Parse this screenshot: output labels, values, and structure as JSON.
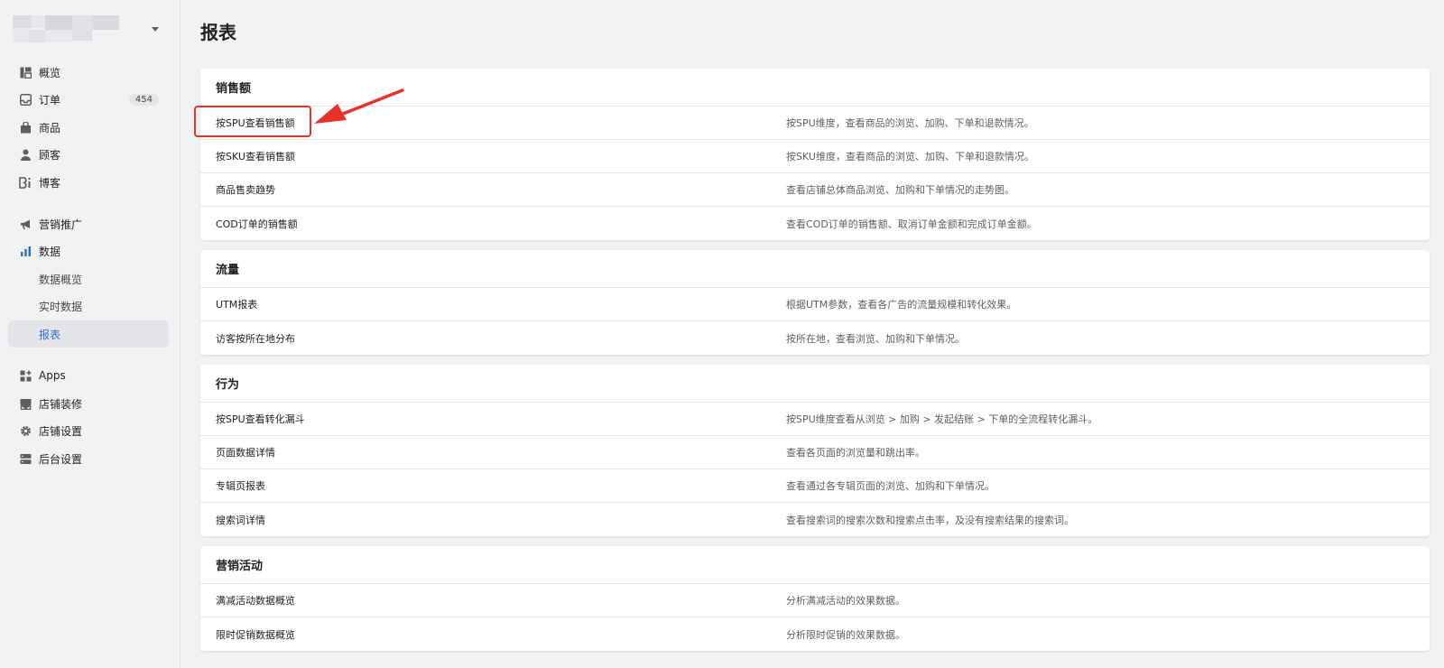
{
  "sidebar": {
    "items": [
      {
        "label": "概览",
        "icon": "overview-icon"
      },
      {
        "label": "订单",
        "icon": "inbox-icon",
        "badge": "454"
      },
      {
        "label": "商品",
        "icon": "bag-icon"
      },
      {
        "label": "顾客",
        "icon": "person-icon"
      },
      {
        "label": "博客",
        "icon": "blog-icon"
      },
      {
        "label": "营销推广",
        "icon": "megaphone-icon"
      },
      {
        "label": "数据",
        "icon": "bar-chart-icon"
      },
      {
        "label": "Apps",
        "icon": "apps-icon"
      },
      {
        "label": "店铺装修",
        "icon": "store-icon"
      },
      {
        "label": "店铺设置",
        "icon": "gear-icon"
      },
      {
        "label": "后台设置",
        "icon": "server-icon"
      }
    ],
    "data_sub": [
      "数据概览",
      "实时数据",
      "报表"
    ]
  },
  "page": {
    "title": "报表"
  },
  "sections": [
    {
      "title": "销售额",
      "rows": [
        {
          "name": "按SPU查看销售额",
          "desc": "按SPU维度，查看商品的浏览、加购、下单和退款情况。"
        },
        {
          "name": "按SKU查看销售额",
          "desc": "按SKU维度，查看商品的浏览、加购、下单和退款情况。"
        },
        {
          "name": "商品售卖趋势",
          "desc": "查看店铺总体商品浏览、加购和下单情况的走势图。"
        },
        {
          "name": "COD订单的销售额",
          "desc": "查看COD订单的销售额、取消订单金额和完成订单金额。"
        }
      ]
    },
    {
      "title": "流量",
      "rows": [
        {
          "name": "UTM报表",
          "desc": "根据UTM参数，查看各广告的流量规模和转化效果。"
        },
        {
          "name": "访客按所在地分布",
          "desc": "按所在地，查看浏览、加购和下单情况。"
        }
      ]
    },
    {
      "title": "行为",
      "rows": [
        {
          "name": "按SPU查看转化漏斗",
          "desc": "按SPU维度查看从浏览 > 加购 > 发起结账 > 下单的全流程转化漏斗。"
        },
        {
          "name": "页面数据详情",
          "desc": "查看各页面的浏览量和跳出率。"
        },
        {
          "name": "专辑页报表",
          "desc": "查看通过各专辑页面的浏览、加购和下单情况。"
        },
        {
          "name": "搜索词详情",
          "desc": "查看搜索词的搜索次数和搜索点击率，及没有搜索结果的搜索词。"
        }
      ]
    },
    {
      "title": "营销活动",
      "rows": [
        {
          "name": "满减活动数据概览",
          "desc": "分析满减活动的效果数据。"
        },
        {
          "name": "限时促销数据概览",
          "desc": "分析限时促销的效果数据。"
        }
      ]
    }
  ],
  "colors": {
    "accent": "#2c6ecb",
    "annotation": "#e8322a"
  }
}
